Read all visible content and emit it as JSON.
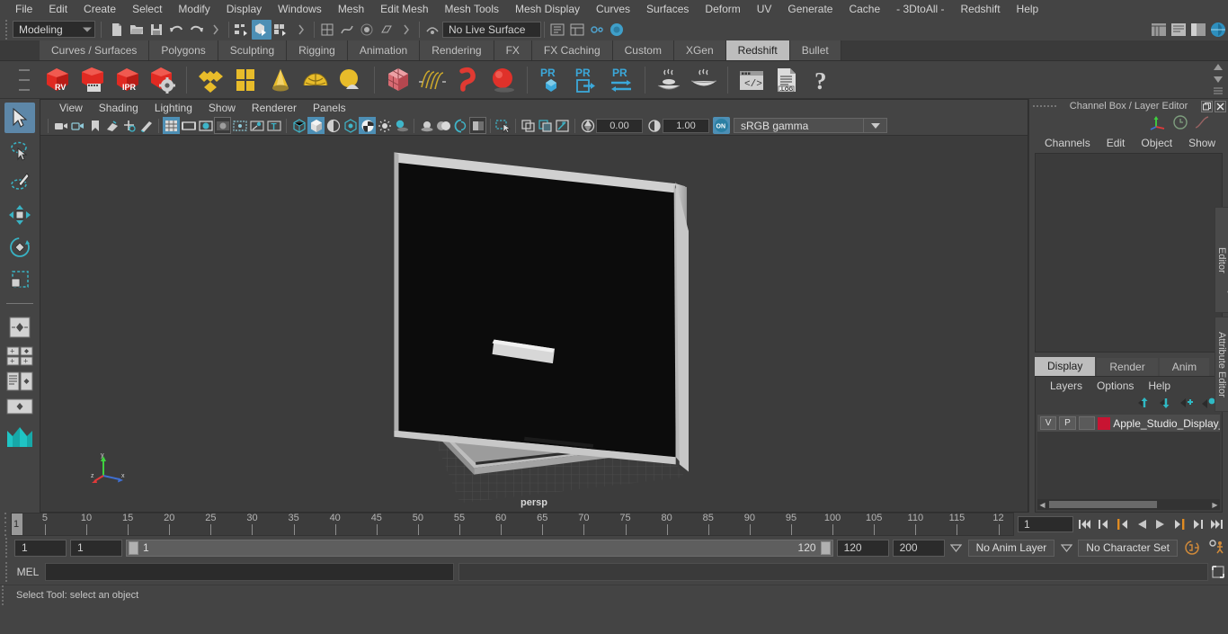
{
  "menubar": {
    "items": [
      "File",
      "Edit",
      "Create",
      "Select",
      "Modify",
      "Display",
      "Windows",
      "Mesh",
      "Edit Mesh",
      "Mesh Tools",
      "Mesh Display",
      "Curves",
      "Surfaces",
      "Deform",
      "UV",
      "Generate",
      "Cache",
      "- 3DtoAll -",
      "Redshift",
      "Help"
    ]
  },
  "statusrow": {
    "menu_set": "Modeling",
    "live_surface": "No Live Surface"
  },
  "shelf": {
    "tabs": [
      "Curves / Surfaces",
      "Polygons",
      "Sculpting",
      "Rigging",
      "Animation",
      "Rendering",
      "FX",
      "FX Caching",
      "Custom",
      "XGen",
      "Redshift",
      "Bullet"
    ],
    "active_tab": "Redshift",
    "icons": [
      {
        "name": "redshift-render-view",
        "label": "RV"
      },
      {
        "name": "redshift-render-sequence",
        "label": ""
      },
      {
        "name": "redshift-ipr",
        "label": "IPR"
      },
      {
        "name": "redshift-render-settings",
        "label": ""
      },
      {
        "name": "redshift-material",
        "label": ""
      },
      {
        "name": "redshift-material-grid",
        "label": ""
      },
      {
        "name": "redshift-light-cone",
        "label": ""
      },
      {
        "name": "redshift-dome-light",
        "label": ""
      },
      {
        "name": "redshift-ies-light",
        "label": ""
      },
      {
        "name": "redshift-proxy-cube",
        "label": ""
      },
      {
        "name": "redshift-hair",
        "label": ""
      },
      {
        "name": "redshift-volume",
        "label": ""
      },
      {
        "name": "redshift-sphere-sss",
        "label": ""
      },
      {
        "name": "redshift-pr-object",
        "label": "PR"
      },
      {
        "name": "redshift-pr-export",
        "label": "PR"
      },
      {
        "name": "redshift-pr-transfer",
        "label": "PR"
      },
      {
        "name": "redshift-bake-single",
        "label": ""
      },
      {
        "name": "redshift-bake-all",
        "label": ""
      },
      {
        "name": "redshift-script-editor",
        "label": ""
      },
      {
        "name": "redshift-log",
        "label": ".LOG"
      },
      {
        "name": "redshift-help",
        "label": "?"
      }
    ]
  },
  "toolbox": {
    "tools": [
      {
        "name": "select-tool",
        "selected": true
      },
      {
        "name": "lasso-select-tool",
        "selected": false
      },
      {
        "name": "paint-select-tool",
        "selected": false
      },
      {
        "name": "move-tool",
        "selected": false
      },
      {
        "name": "rotate-tool",
        "selected": false
      },
      {
        "name": "scale-tool",
        "selected": false
      }
    ],
    "layouts": [
      {
        "name": "single-perspective-layout"
      },
      {
        "name": "four-view-layout"
      },
      {
        "name": "outliner-persp-layout"
      },
      {
        "name": "persp-graph-layout"
      },
      {
        "name": "maya-logo"
      }
    ]
  },
  "viewport": {
    "menus": [
      "View",
      "Shading",
      "Lighting",
      "Show",
      "Renderer",
      "Panels"
    ],
    "camera_label": "persp",
    "exposure": "0.00",
    "gamma": "1.00",
    "color_space": "sRGB gamma",
    "color_mgmt_toggle": "ON",
    "axis": {
      "x": "x",
      "y": "y",
      "z": "z"
    }
  },
  "channelbox": {
    "title": "Channel Box / Layer Editor",
    "menus": [
      "Channels",
      "Edit",
      "Object",
      "Show"
    ]
  },
  "layereditor": {
    "tabs": [
      "Display",
      "Render",
      "Anim"
    ],
    "active_tab": "Display",
    "menus": [
      "Layers",
      "Options",
      "Help"
    ],
    "layers": [
      {
        "visibility": "V",
        "playback": "P",
        "type": "",
        "color": "#c81432",
        "name": "Apple_Studio_Display_"
      }
    ]
  },
  "sidetabs": [
    "Channel Box / Layer Editor",
    "Attribute Editor"
  ],
  "timeline": {
    "tick_labels": [
      "5",
      "10",
      "15",
      "20",
      "25",
      "30",
      "35",
      "40",
      "45",
      "50",
      "55",
      "60",
      "65",
      "70",
      "75",
      "80",
      "85",
      "90",
      "95",
      "100",
      "105",
      "110",
      "115",
      "12"
    ],
    "current_frame_marker": "1",
    "current_frame_field": "1",
    "playback_buttons": [
      {
        "name": "go-to-start-button"
      },
      {
        "name": "step-back-frame-button"
      },
      {
        "name": "step-back-key-button"
      },
      {
        "name": "play-backwards-button"
      },
      {
        "name": "play-forwards-button"
      },
      {
        "name": "step-forward-key-button"
      },
      {
        "name": "step-forward-frame-button"
      },
      {
        "name": "go-to-end-button"
      }
    ]
  },
  "rangerow": {
    "anim_start": "1",
    "range_start": "1",
    "slider_start_label": "1",
    "slider_end_label": "120",
    "range_end": "120",
    "anim_end": "200",
    "anim_layer": "No Anim Layer",
    "character_set": "No Character Set"
  },
  "command_line": {
    "language_label": "MEL",
    "input_value": "",
    "input_placeholder": ""
  },
  "statusbar": {
    "message": "Select Tool: select an object"
  }
}
